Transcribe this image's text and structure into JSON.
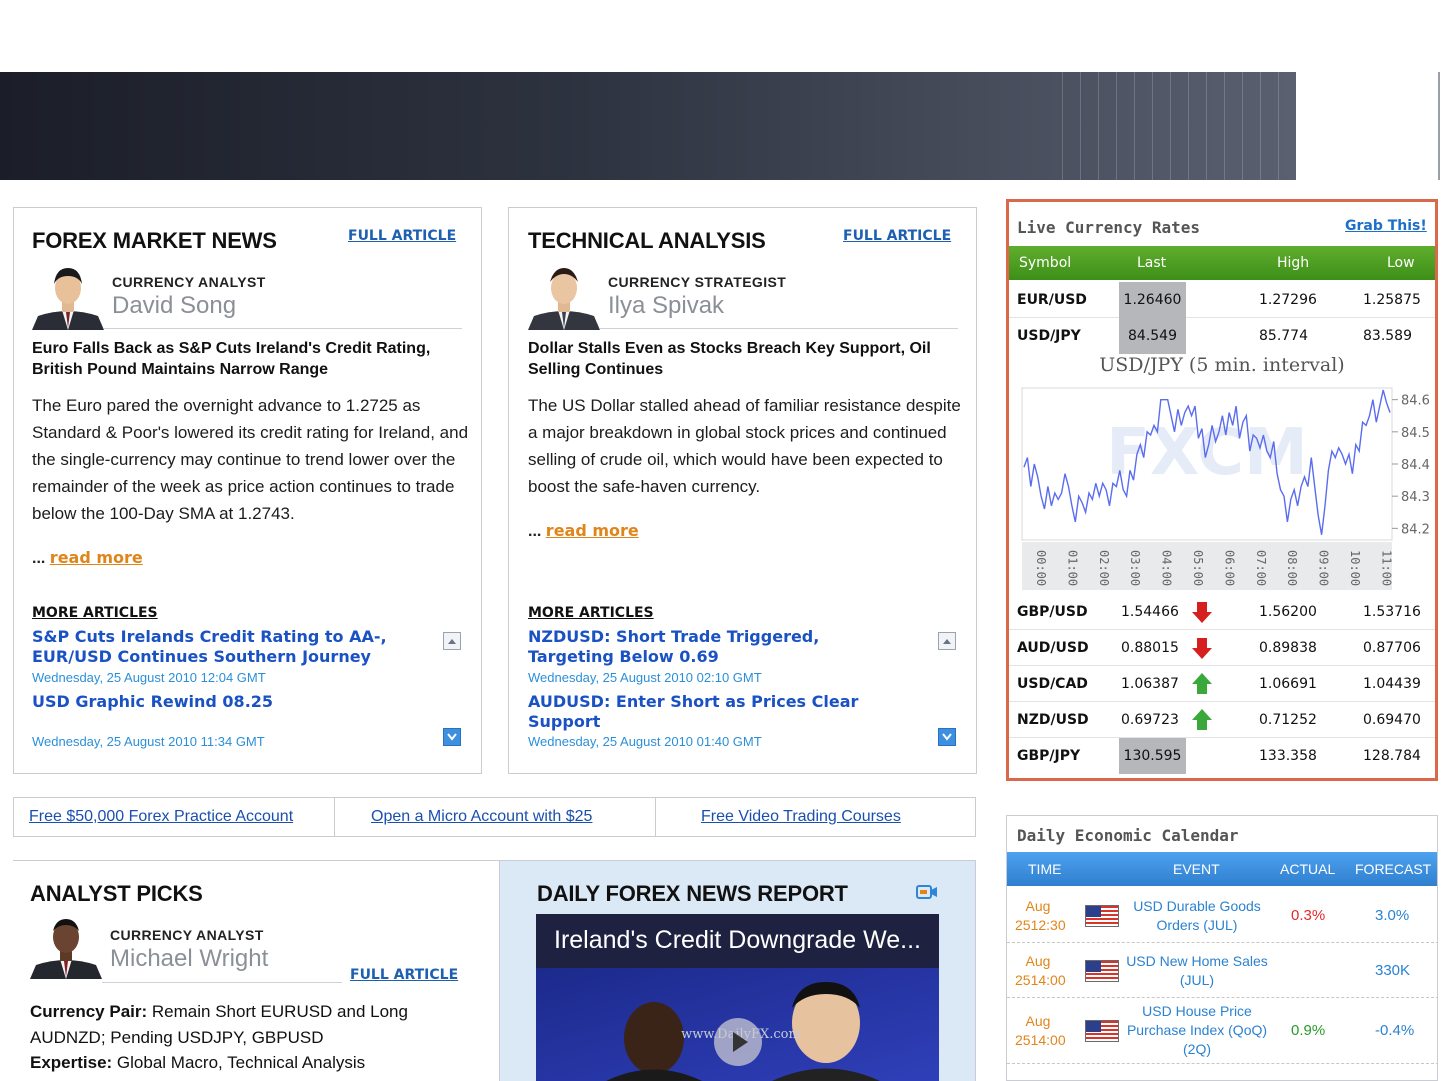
{
  "news": {
    "title": "FOREX MARKET NEWS",
    "full_article": "FULL ARTICLE",
    "role": "CURRENCY ANALYST",
    "analyst": "David Song",
    "headline": "Euro Falls Back as S&P Cuts Ireland's Credit Rating, British Pound Maintains Narrow Range",
    "body": "The Euro pared the overnight advance to 1.2725 as Standard & Poor's lowered its credit rating for Ireland, and the single-currency may continue to trend lower over the remainder of the week as price action continues to trade below the 100-Day SMA at 1.2743.",
    "dots": "...",
    "read_more": "read more",
    "more_articles": "MORE ARTICLES",
    "articles": [
      {
        "title": "S&P Cuts Irelands Credit Rating to AA-, EUR/USD Continues Southern Journey",
        "date": "Wednesday, 25 August 2010 12:04 GMT"
      },
      {
        "title": "USD Graphic Rewind 08.25",
        "date": "Wednesday, 25 August 2010 11:34 GMT"
      }
    ]
  },
  "technical": {
    "title": "TECHNICAL ANALYSIS",
    "full_article": "FULL ARTICLE",
    "role": "CURRENCY STRATEGIST",
    "analyst": "Ilya Spivak",
    "headline": "Dollar Stalls Even as Stocks Breach Key Support, Oil Selling Continues",
    "body": "The US Dollar stalled ahead of familiar resistance despite a major breakdown in global stock prices and continued selling of crude oil, which would have been expected to boost the safe-haven currency.",
    "dots": "...",
    "read_more": "read more",
    "more_articles": "MORE ARTICLES",
    "articles": [
      {
        "title": "NZDUSD: Short Trade Triggered, Targeting Below 0.69",
        "date": "Wednesday, 25 August 2010 02:10 GMT"
      },
      {
        "title": "AUDUSD: Enter Short as Prices Clear Support",
        "date": "Wednesday, 25 August 2010 01:40 GMT"
      }
    ]
  },
  "rates": {
    "title": "Live Currency Rates",
    "grab": "Grab This!",
    "headers": {
      "symbol": "Symbol",
      "last": "Last",
      "high": "High",
      "low": "Low"
    },
    "top_rows": [
      {
        "symbol": "EUR/USD",
        "last": "1.26460",
        "high": "1.27296",
        "low": "1.25875"
      },
      {
        "symbol": "USD/JPY",
        "last": "84.549",
        "high": "85.774",
        "low": "83.589"
      }
    ],
    "bottom_rows": [
      {
        "symbol": "GBP/USD",
        "last": "1.54466",
        "high": "1.56200",
        "low": "1.53716",
        "dir": "down"
      },
      {
        "symbol": "AUD/USD",
        "last": "0.88015",
        "high": "0.89838",
        "low": "0.87706",
        "dir": "down"
      },
      {
        "symbol": "USD/CAD",
        "last": "1.06387",
        "high": "1.06691",
        "low": "1.04439",
        "dir": "up"
      },
      {
        "symbol": "NZD/USD",
        "last": "0.69723",
        "high": "0.71252",
        "low": "0.69470",
        "dir": "up"
      },
      {
        "symbol": "GBP/JPY",
        "last": "130.595",
        "high": "133.358",
        "low": "128.784",
        "dir": "none"
      }
    ],
    "colors": {
      "header": "#4a9a22",
      "border": "#d9694a",
      "down": "#d62020",
      "up": "#3aa83a"
    }
  },
  "chart_data": {
    "type": "line",
    "title": "USD/JPY (5 min. interval)",
    "watermark": "FXCM",
    "x": [
      "00:00",
      "01:00",
      "02:00",
      "03:00",
      "04:00",
      "05:00",
      "06:00",
      "07:00",
      "08:00",
      "09:00",
      "10:00",
      "11:00"
    ],
    "ylim": [
      84.17,
      84.63
    ],
    "yticks": [
      "84.6",
      "84.5",
      "84.4",
      "84.3",
      "84.2"
    ],
    "ytick_values": [
      84.6,
      84.5,
      84.4,
      84.3,
      84.2
    ],
    "series": [
      {
        "values": [
          84.39,
          84.42,
          84.33,
          84.4,
          84.36,
          84.3,
          84.26,
          84.33,
          84.27,
          84.31,
          84.29,
          84.31,
          84.37,
          84.33,
          84.27,
          84.22,
          84.3,
          84.28,
          84.25,
          84.31,
          84.29,
          84.34,
          84.3,
          84.34,
          84.32,
          84.27,
          84.34,
          84.33,
          84.38,
          84.32,
          84.3,
          84.38,
          84.35,
          84.43,
          84.46,
          84.42,
          84.5,
          84.49,
          84.52,
          84.5,
          84.6,
          84.6,
          84.6,
          84.55,
          84.5,
          84.57,
          84.52,
          84.56,
          84.58,
          84.55,
          84.58,
          84.48,
          84.51,
          84.42,
          84.46,
          84.52,
          84.47,
          84.5,
          84.55,
          84.49,
          84.56,
          84.52,
          84.58,
          84.48,
          84.53,
          84.55,
          84.44,
          84.49,
          84.48,
          84.45,
          84.49,
          84.44,
          84.42,
          84.47,
          84.37,
          84.32,
          84.3,
          84.22,
          84.29,
          84.32,
          84.27,
          84.33,
          84.36,
          84.33,
          84.42,
          84.33,
          84.24,
          84.18,
          84.27,
          84.38,
          84.44,
          84.42,
          84.45,
          84.43,
          84.4,
          84.43,
          84.37,
          84.46,
          84.44,
          84.53,
          84.52,
          84.55,
          84.6,
          84.53,
          84.58,
          84.63,
          84.59,
          84.56
        ]
      }
    ],
    "line_color": "#5a6cf0"
  },
  "links": [
    "Free $50,000 Forex Practice Account",
    "Open a Micro Account with $25",
    "Free Video Trading Courses"
  ],
  "calendar": {
    "title": "Daily Economic Calendar",
    "headers": {
      "time": "TIME",
      "event": "EVENT",
      "actual": "ACTUAL",
      "forecast": "FORECAST"
    },
    "rows": [
      {
        "date": "Aug",
        "time": "2512:30",
        "event": "USD Durable Goods Orders (JUL)",
        "actual": "0.3%",
        "actual_color": "red",
        "forecast": "3.0%"
      },
      {
        "date": "Aug",
        "time": "2514:00",
        "event": "USD New Home Sales (JUL)",
        "actual": "",
        "actual_color": "none",
        "forecast": "330K"
      },
      {
        "date": "Aug",
        "time": "2514:00",
        "event": "USD House Price Purchase Index (QoQ) (2Q)",
        "actual": "0.9%",
        "actual_color": "green",
        "forecast": "-0.4%"
      }
    ]
  },
  "picks": {
    "title": "ANALYST PICKS",
    "role": "CURRENCY ANALYST",
    "analyst": "Michael Wright",
    "full_article": "FULL ARTICLE",
    "pair_label": "Currency Pair:",
    "pair_value": " Remain Short EURUSD and Long AUDNZD; Pending USDJPY, GBPUSD",
    "expertise_label": "Expertise:",
    "expertise_value": " Global Macro, Technical Analysis"
  },
  "report": {
    "title": "DAILY FOREX NEWS REPORT",
    "video_title": "Ireland's Credit Downgrade We...",
    "video_watermark": "www.DailyFX.com"
  }
}
